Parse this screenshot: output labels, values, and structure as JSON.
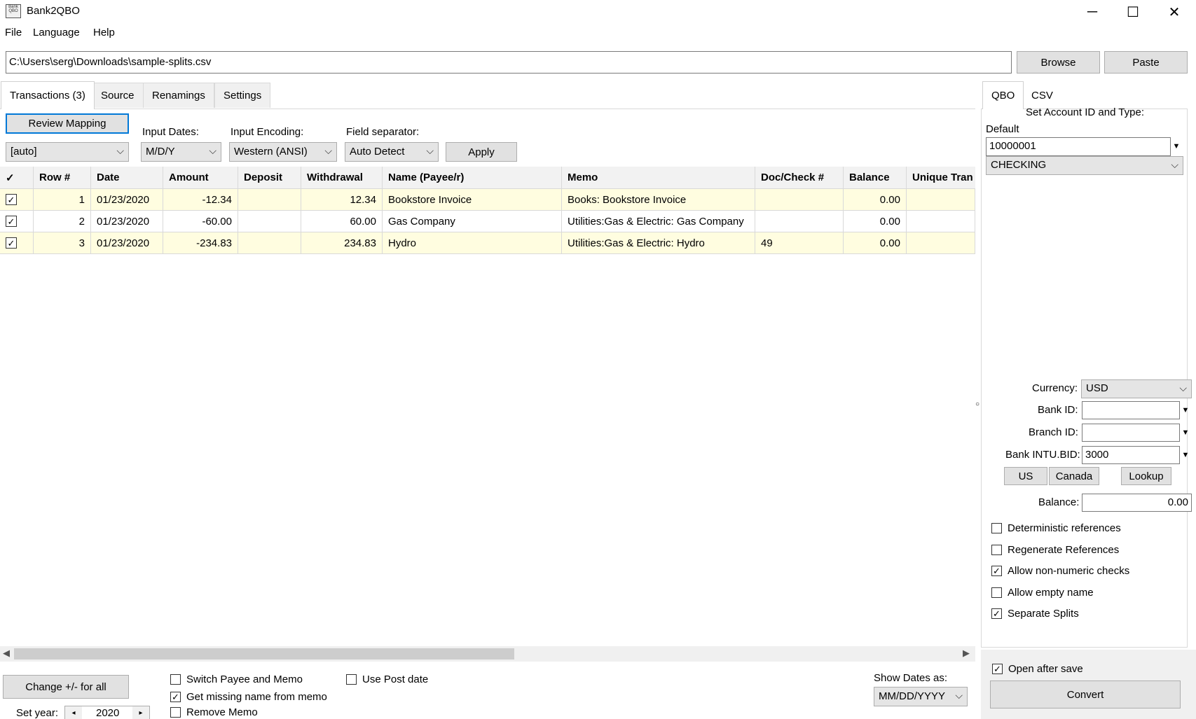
{
  "window": {
    "title": "Bank2QBO",
    "icon_text": "Bank QBO",
    "controls": {
      "minimize": "─",
      "maximize": "☐",
      "close": "✕"
    }
  },
  "menu": [
    "File",
    "Language",
    "Help"
  ],
  "path": {
    "value": "C:\\Users\\serg\\Downloads\\sample-splits.csv",
    "browse_label": "Browse",
    "paste_label": "Paste"
  },
  "left_tabs": [
    "Transactions (3)",
    "Source",
    "Renamings",
    "Settings"
  ],
  "toolbar": {
    "review_mapping_label": "Review Mapping",
    "mapping_value": "[auto]",
    "input_dates_label": "Input Dates:",
    "input_dates_value": "M/D/Y",
    "input_encoding_label": "Input Encoding:",
    "input_encoding_value": "Western (ANSI)",
    "field_separator_label": "Field separator:",
    "field_separator_value": "Auto Detect",
    "apply_label": "Apply"
  },
  "grid": {
    "columns": [
      "✓",
      "Row #",
      "Date",
      "Amount",
      "Deposit",
      "Withdrawal",
      "Name (Payee/r)",
      "Memo",
      "Doc/Check #",
      "Balance",
      "Unique Tran"
    ],
    "rows": [
      {
        "checked": true,
        "row": "1",
        "date": "01/23/2020",
        "amount": "-12.34",
        "deposit": "",
        "withdrawal": "12.34",
        "name": "Bookstore Invoice",
        "memo": "Books: Bookstore Invoice",
        "doc": "",
        "balance": "0.00",
        "unique": ""
      },
      {
        "checked": true,
        "row": "2",
        "date": "01/23/2020",
        "amount": "-60.00",
        "deposit": "",
        "withdrawal": "60.00",
        "name": "Gas Company",
        "memo": "Utilities:Gas & Electric: Gas Company",
        "doc": "",
        "balance": "0.00",
        "unique": ""
      },
      {
        "checked": true,
        "row": "3",
        "date": "01/23/2020",
        "amount": "-234.83",
        "deposit": "",
        "withdrawal": "234.83",
        "name": "Hydro",
        "memo": "Utilities:Gas & Electric: Hydro",
        "doc": "49",
        "balance": "0.00",
        "unique": ""
      }
    ]
  },
  "bottom": {
    "change_sign_label": "Change +/- for all",
    "set_year_label": "Set year:",
    "year_value": "2020",
    "switch_payee_label": "Switch Payee and Memo",
    "switch_payee_checked": false,
    "get_missing_label": "Get missing name from memo",
    "get_missing_checked": true,
    "remove_memo_label": "Remove Memo",
    "remove_memo_checked": false,
    "use_post_date_label": "Use Post date",
    "use_post_date_checked": false,
    "show_dates_label": "Show Dates as:",
    "show_dates_value": "MM/DD/YYYY"
  },
  "right_tabs": [
    "QBO",
    "CSV"
  ],
  "qbo": {
    "set_account_label": "Set Account ID and Type:",
    "default_label": "Default",
    "account_id": "10000001",
    "account_type": "CHECKING",
    "currency_label": "Currency:",
    "currency_value": "USD",
    "bank_id_label": "Bank ID:",
    "bank_id_value": "",
    "branch_id_label": "Branch ID:",
    "branch_id_value": "",
    "intu_bid_label": "Bank INTU.BID:",
    "intu_bid_value": "3000",
    "us_label": "US",
    "canada_label": "Canada",
    "lookup_label": "Lookup",
    "balance_label": "Balance:",
    "balance_value": "0.00",
    "options": [
      {
        "label": "Deterministic references",
        "checked": false
      },
      {
        "label": "Regenerate References",
        "checked": false
      },
      {
        "label": "Allow non-numeric checks",
        "checked": true
      },
      {
        "label": "Allow empty name",
        "checked": false
      },
      {
        "label": "Separate Splits",
        "checked": true
      }
    ],
    "open_after_save_label": "Open after save",
    "open_after_save_checked": true,
    "convert_label": "Convert"
  }
}
